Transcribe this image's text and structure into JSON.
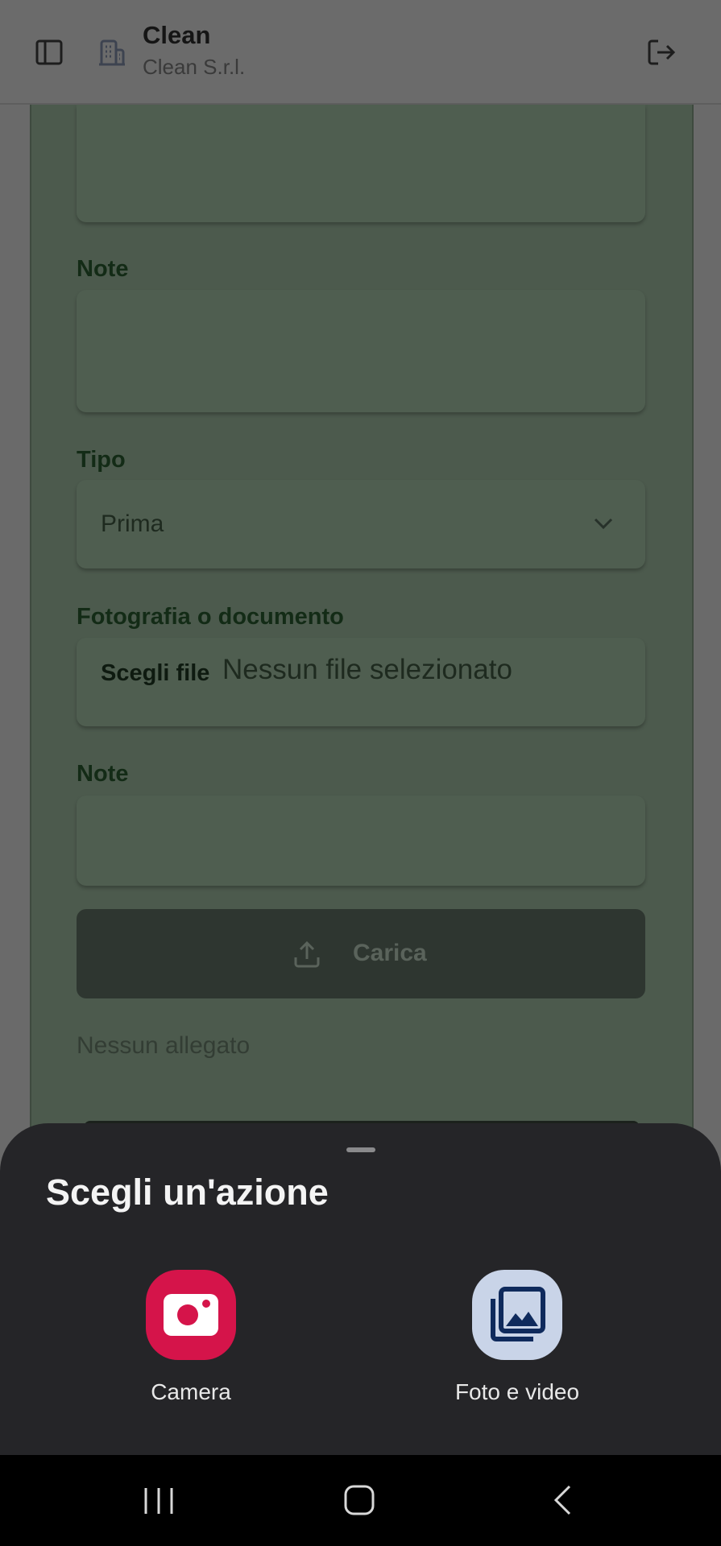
{
  "header": {
    "title": "Clean",
    "subtitle": "Clean S.r.l."
  },
  "form": {
    "note_label_1": "Note",
    "tipo_label": "Tipo",
    "tipo_value": "Prima",
    "photo_label": "Fotografia o documento",
    "file_button": "Scegli file",
    "file_status": "Nessun file selezionato",
    "note_label_2": "Note",
    "upload_button": "Carica",
    "no_attachments": "Nessun allegato"
  },
  "sheet": {
    "title": "Scegli un'azione",
    "apps": [
      {
        "label": "Camera",
        "icon": "camera-icon",
        "color": "#d5144a"
      },
      {
        "label": "Foto e video",
        "icon": "gallery-icon",
        "color": "#c9d4e8"
      }
    ]
  },
  "colors": {
    "scrim_card": "#4c5a4d",
    "sheet_bg": "#252528"
  }
}
